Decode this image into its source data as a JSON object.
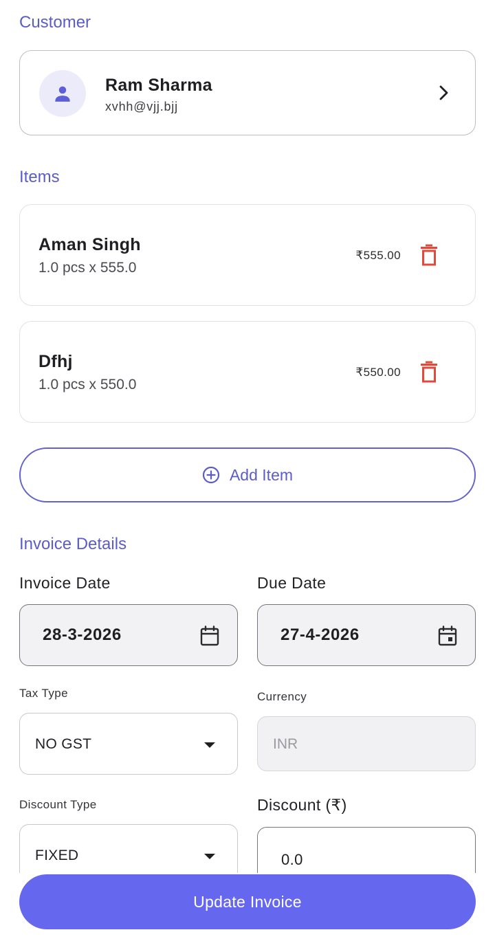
{
  "customer": {
    "section_title": "Customer",
    "name": "Ram Sharma",
    "email": "xvhh@vjj.bjj"
  },
  "items": {
    "section_title": "Items",
    "list": [
      {
        "name": "Aman Singh",
        "qty": "1.0 pcs x 555.0",
        "price": "₹555.00"
      },
      {
        "name": "Dfhj",
        "qty": "1.0 pcs x 550.0",
        "price": "₹550.00"
      }
    ],
    "add_label": "Add Item"
  },
  "invoice": {
    "section_title": "Invoice Details",
    "invoice_date_label": "Invoice Date",
    "invoice_date": "28-3-2026",
    "due_date_label": "Due Date",
    "due_date": "27-4-2026",
    "tax_type_label": "Tax Type",
    "tax_type": "NO GST",
    "currency_label": "Currency",
    "currency": "INR",
    "discount_type_label": "Discount Type",
    "discount_type": "FIXED",
    "discount_label": "Discount (₹)",
    "discount": "0.0"
  },
  "footer": {
    "update_label": "Update Invoice"
  },
  "colors": {
    "accent": "#6567ee",
    "section": "#5c5cc7",
    "danger": "#e04a3c"
  },
  "icons": [
    "person-icon",
    "chevron-right-icon",
    "trash-icon",
    "add-circle-icon",
    "calendar-icon",
    "dropdown-caret-icon"
  ]
}
